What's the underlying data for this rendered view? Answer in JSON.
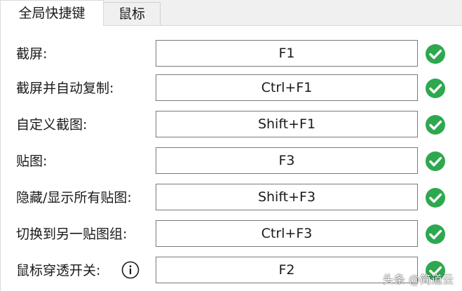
{
  "tabs": [
    {
      "label": "全局快捷键",
      "active": true
    },
    {
      "label": "鼠标",
      "active": false
    }
  ],
  "hotkeys": [
    {
      "label": "截屏:",
      "value": "F1",
      "status_icon": "check-circle-icon"
    },
    {
      "label": "截屏并自动复制:",
      "value": "Ctrl+F1",
      "status_icon": "check-circle-icon"
    },
    {
      "label": "自定义截图:",
      "value": "Shift+F1",
      "status_icon": "check-circle-icon"
    },
    {
      "label": "贴图:",
      "value": "F3",
      "status_icon": "check-circle-icon"
    },
    {
      "label": "隐藏/显示所有贴图:",
      "value": "Shift+F3",
      "status_icon": "check-circle-icon"
    },
    {
      "label": "切换到另一贴图组:",
      "value": "Ctrl+F3",
      "status_icon": "check-circle-icon"
    },
    {
      "label": "鼠标穿透开关:",
      "value": "F2",
      "status_icon": "check-circle-icon",
      "info_icon": "info-circle-icon"
    }
  ],
  "watermark": "头条 @简道云",
  "colors": {
    "check_green": "#2ea84f",
    "panel_bg": "#ffffff",
    "window_bg": "#f0f0f0",
    "box_border": "#7a7a7a"
  }
}
